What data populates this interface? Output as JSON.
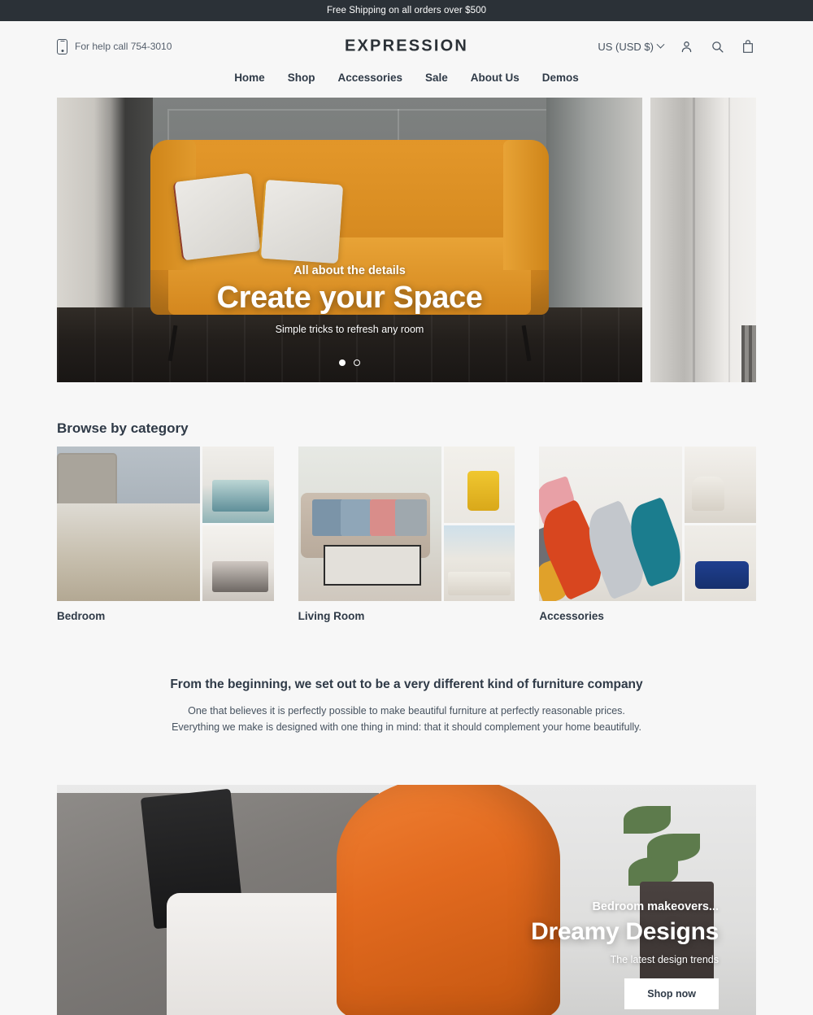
{
  "announcement": {
    "text": "Free Shipping on all orders over $500"
  },
  "header": {
    "help_text": "For help call 754-3010",
    "logo": "EXPRESSION",
    "currency": "US (USD $)",
    "icons": {
      "phone": "mobile-phone-icon",
      "chevron": "chevron-down-icon",
      "account": "account-icon",
      "search": "search-icon",
      "cart": "shopping-bag-icon"
    }
  },
  "nav": {
    "items": [
      {
        "label": "Home"
      },
      {
        "label": "Shop"
      },
      {
        "label": "Accessories"
      },
      {
        "label": "Sale"
      },
      {
        "label": "About Us"
      },
      {
        "label": "Demos"
      }
    ]
  },
  "hero": {
    "eyebrow": "All about the details",
    "title": "Create your Space",
    "subtitle": "Simple tricks to refresh any room",
    "dots": [
      {
        "state": "active"
      },
      {
        "state": "inactive"
      }
    ]
  },
  "categories": {
    "title": "Browse by category",
    "items": [
      {
        "label": "Bedroom"
      },
      {
        "label": "Living Room"
      },
      {
        "label": "Accessories"
      }
    ]
  },
  "mission": {
    "heading": "From the beginning, we set out to be a very different kind of furniture company",
    "line1": "One that believes it is perfectly possible to make beautiful furniture at perfectly reasonable prices.",
    "line2": "Everything we make is designed with one thing in mind: that it should complement your home beautifully."
  },
  "banner": {
    "eyebrow": "Bedroom makeovers...",
    "title": "Dreamy Designs",
    "subtitle": "The latest design trends",
    "button_label": "Shop now"
  },
  "colors": {
    "announce_bg": "#2b3137",
    "page_bg": "#f7f7f7",
    "text": "#2f3a47",
    "muted_text": "#46525f",
    "hero_sofa": "#d98d22",
    "banner_chair": "#e26a1f"
  }
}
